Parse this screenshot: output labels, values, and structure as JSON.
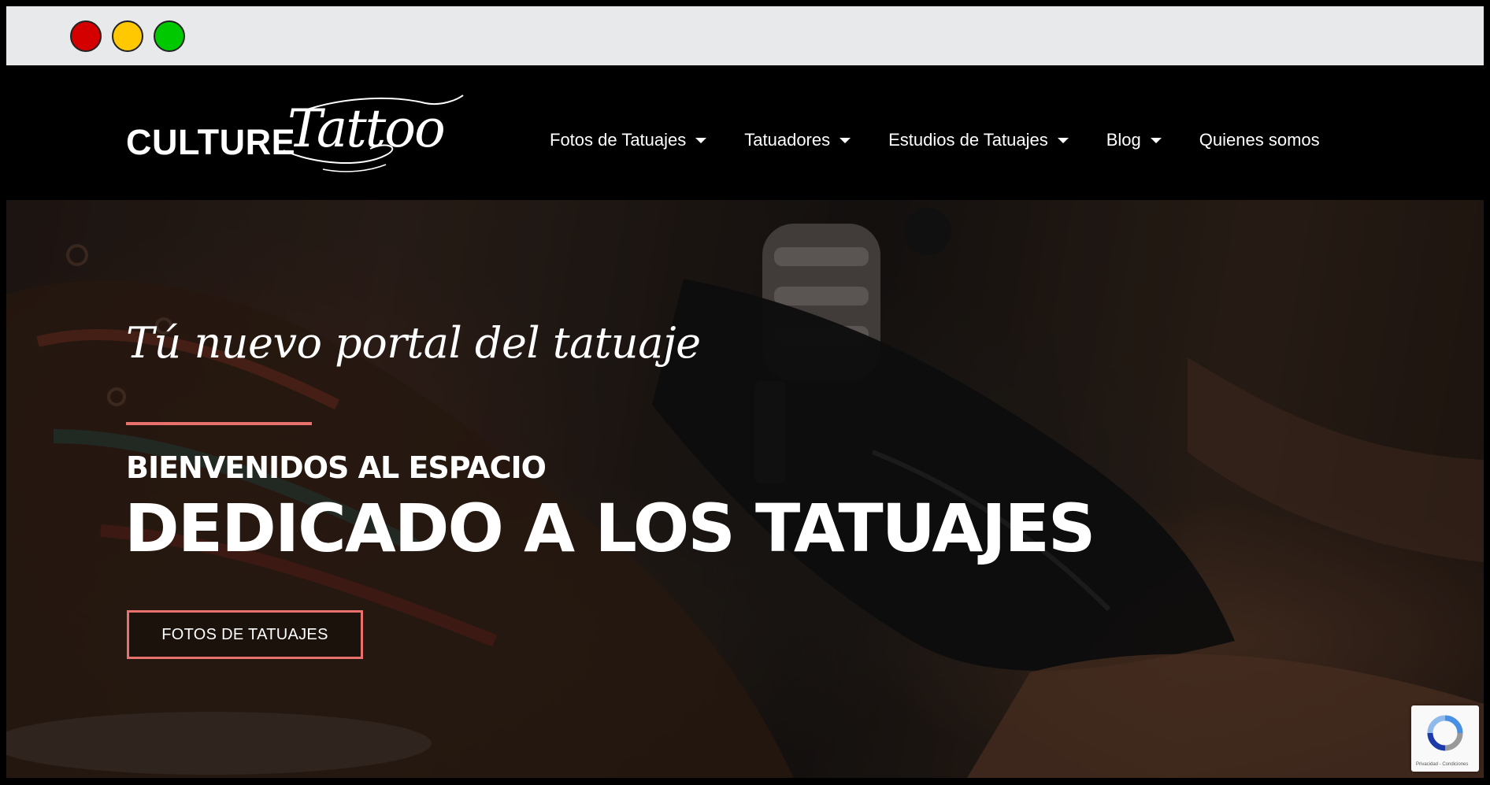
{
  "window": {
    "controls": [
      "close",
      "minimize",
      "maximize"
    ],
    "colors": {
      "close": "#d40000",
      "minimize": "#ffc800",
      "maximize": "#00c800"
    }
  },
  "header": {
    "logo_word": "CULTURE",
    "logo_script": "Tattoo",
    "nav": [
      {
        "label": "Fotos de Tatuajes",
        "has_dropdown": true
      },
      {
        "label": "Tatuadores",
        "has_dropdown": true
      },
      {
        "label": "Estudios de Tatuajes",
        "has_dropdown": true
      },
      {
        "label": "Blog",
        "has_dropdown": true
      },
      {
        "label": "Quienes somos",
        "has_dropdown": false
      }
    ]
  },
  "hero": {
    "tagline": "Tú nuevo portal del tatuaje",
    "subtitle": "BIENVENIDOS AL ESPACIO",
    "title": "DEDICADO A LOS TATUAJES",
    "cta_label": "FOTOS DE TATUAJES",
    "accent_color": "#e9716d"
  },
  "recaptcha": {
    "text": "Privacidad - Condiciones"
  }
}
